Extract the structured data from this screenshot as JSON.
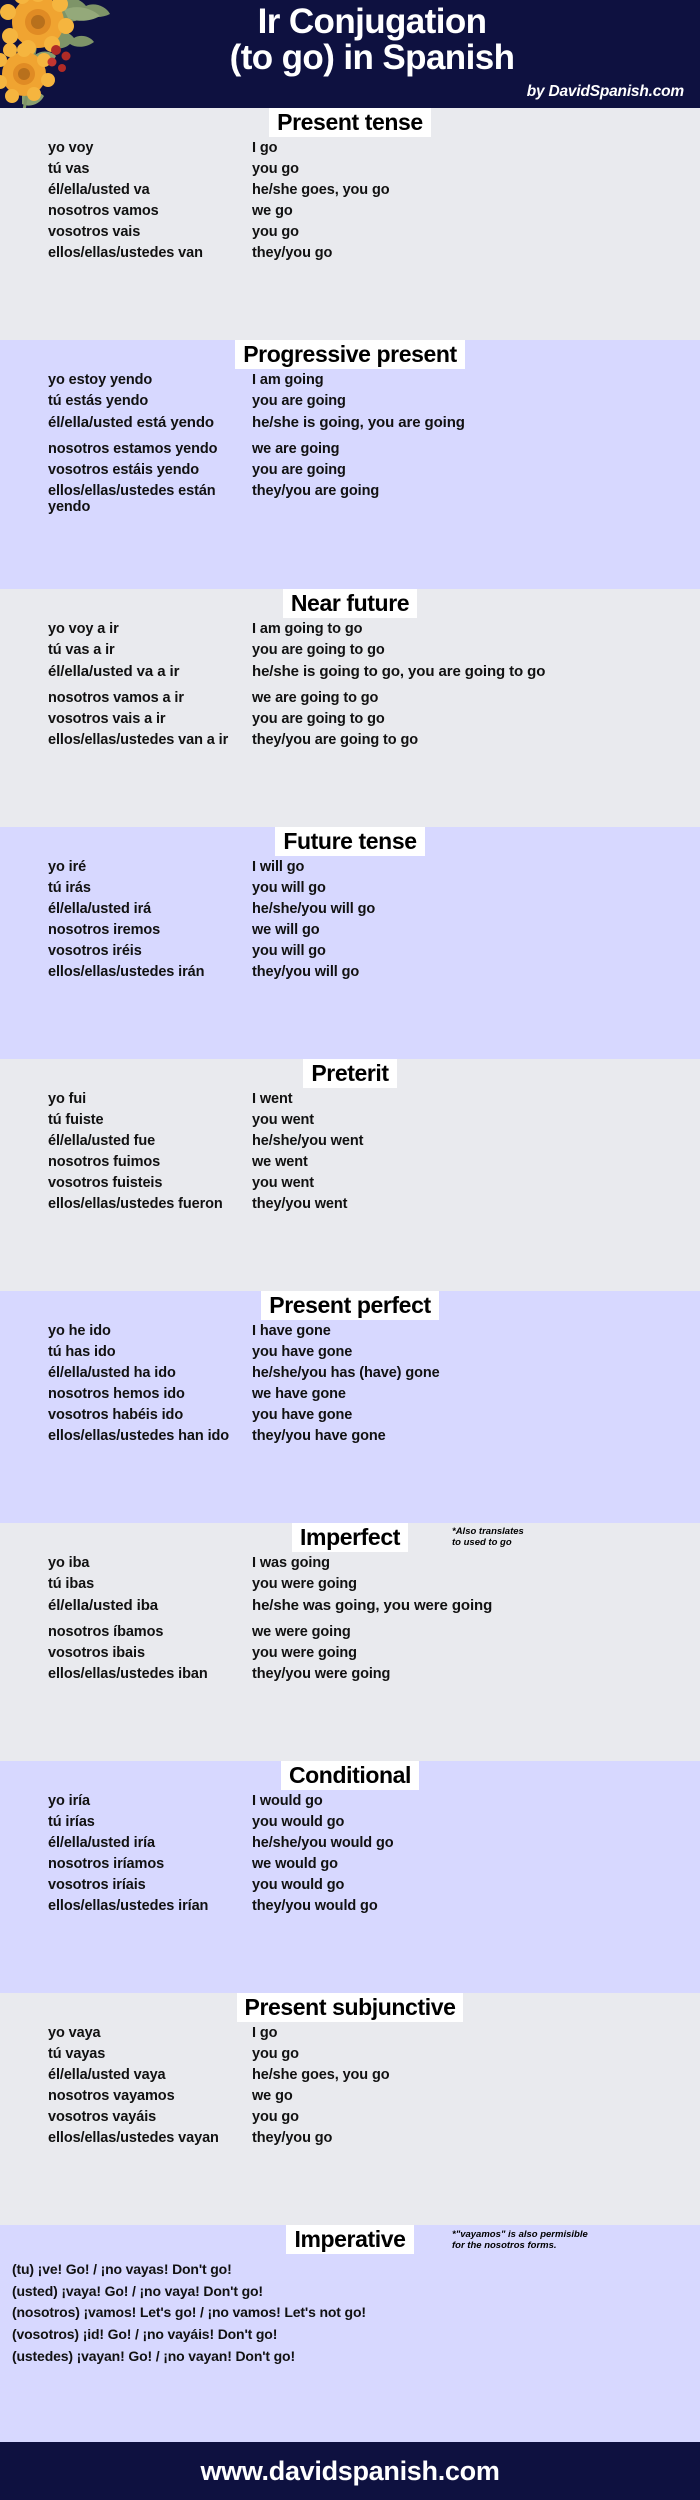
{
  "header": {
    "title_line1": "Ir Conjugation",
    "title_line2": "(to go) in Spanish",
    "byline": "by DavidSpanish.com",
    "background_color": "#0e1140",
    "floral_icon": "floral-decoration"
  },
  "theme": {
    "plain_background": "#e9eaee",
    "alt_background": "#d7d8ff",
    "title_chip_background": "#ffffff",
    "text_color": "#111111"
  },
  "sections": [
    {
      "title": "Present tense",
      "shade": "plain",
      "note": "",
      "rows": [
        {
          "es": "yo voy",
          "en": "I go",
          "en_small": false
        },
        {
          "es": "tú vas",
          "en": "you go",
          "en_small": false
        },
        {
          "es": "él/ella/usted va",
          "en": "he/she goes, you go",
          "en_small": false
        },
        {
          "es": "nosotros vamos",
          "en": "we go",
          "en_small": false
        },
        {
          "es": "vosotros vais",
          "en": "you go",
          "en_small": false
        },
        {
          "es": "ellos/ellas/ustedes van",
          "en": "they/you go",
          "en_small": false
        }
      ]
    },
    {
      "title": "Progressive present",
      "shade": "alt",
      "note": "",
      "rows": [
        {
          "es": "yo estoy yendo",
          "en": "I am going",
          "en_small": false
        },
        {
          "es": "tú estás yendo",
          "en": "you are going",
          "en_small": false
        },
        {
          "es": "él/ella/usted está yendo",
          "en": "he/she is going, you are going",
          "en_small": true
        },
        {
          "es": "nosotros estamos yendo",
          "en": "we are going",
          "en_small": false
        },
        {
          "es": "vosotros estáis yendo",
          "en": "you are going",
          "en_small": false
        },
        {
          "es": "ellos/ellas/ustedes están yendo",
          "en": "they/you are going",
          "en_small": false
        }
      ]
    },
    {
      "title": "Near future",
      "shade": "plain",
      "note": "",
      "rows": [
        {
          "es": "yo voy a ir",
          "en": "I am going to go",
          "en_small": false
        },
        {
          "es": "tú vas a ir",
          "en": "you are going to go",
          "en_small": false
        },
        {
          "es": "él/ella/usted va a ir",
          "en": "he/she is going to go, you are going to go",
          "en_small": true
        },
        {
          "es": "nosotros vamos a ir",
          "en": "we are going to go",
          "en_small": false
        },
        {
          "es": "vosotros vais a ir",
          "en": "you are going to go",
          "en_small": false
        },
        {
          "es": "ellos/ellas/ustedes van a ir",
          "en": "they/you are going to go",
          "en_small": false
        }
      ]
    },
    {
      "title": "Future tense",
      "shade": "alt",
      "note": "",
      "rows": [
        {
          "es": "yo iré",
          "en": "I will go",
          "en_small": false
        },
        {
          "es": "tú irás",
          "en": "you will go",
          "en_small": false
        },
        {
          "es": "él/ella/usted irá",
          "en": "he/she/you will go",
          "en_small": false
        },
        {
          "es": "nosotros iremos",
          "en": "we will go",
          "en_small": false
        },
        {
          "es": "vosotros iréis",
          "en": "you will go",
          "en_small": false
        },
        {
          "es": "ellos/ellas/ustedes irán",
          "en": "they/you will go",
          "en_small": false
        }
      ]
    },
    {
      "title": "Preterit",
      "shade": "plain",
      "note": "",
      "rows": [
        {
          "es": "yo fui",
          "en": "I went",
          "en_small": false
        },
        {
          "es": "tú fuiste",
          "en": "you went",
          "en_small": false
        },
        {
          "es": "él/ella/usted fue",
          "en": "he/she/you went",
          "en_small": false
        },
        {
          "es": "nosotros fuimos",
          "en": "we went",
          "en_small": false
        },
        {
          "es": "vosotros fuisteis",
          "en": "you went",
          "en_small": false
        },
        {
          "es": "ellos/ellas/ustedes fueron",
          "en": "they/you went",
          "en_small": false
        }
      ]
    },
    {
      "title": "Present perfect",
      "shade": "alt",
      "note": "",
      "rows": [
        {
          "es": "yo he ido",
          "en": "I have gone",
          "en_small": false
        },
        {
          "es": "tú has ido",
          "en": "you have gone",
          "en_small": false
        },
        {
          "es": "él/ella/usted ha ido",
          "en": "he/she/you has (have) gone",
          "en_small": false
        },
        {
          "es": "nosotros hemos ido",
          "en": "we have gone",
          "en_small": false
        },
        {
          "es": "vosotros habéis ido",
          "en": "you have gone",
          "en_small": false
        },
        {
          "es": "ellos/ellas/ustedes han ido",
          "en": "they/you have gone",
          "en_small": false
        }
      ]
    },
    {
      "title": "Imperfect",
      "shade": "plain",
      "note": "*Also translates\nto used to go",
      "rows": [
        {
          "es": "yo iba",
          "en": "I was going",
          "en_small": false
        },
        {
          "es": "tú ibas",
          "en": "you were going",
          "en_small": false
        },
        {
          "es": "él/ella/usted iba",
          "en": "he/she was going, you were going",
          "en_small": true
        },
        {
          "es": "nosotros íbamos",
          "en": "we were going",
          "en_small": false
        },
        {
          "es": "vosotros ibais",
          "en": "you were going",
          "en_small": false
        },
        {
          "es": "ellos/ellas/ustedes iban",
          "en": "they/you were going",
          "en_small": false
        }
      ]
    },
    {
      "title": "Conditional",
      "shade": "alt",
      "note": "",
      "rows": [
        {
          "es": "yo iría",
          "en": "I would go",
          "en_small": false
        },
        {
          "es": "tú irías",
          "en": "you would go",
          "en_small": false
        },
        {
          "es": "él/ella/usted iría",
          "en": "he/she/you would go",
          "en_small": false
        },
        {
          "es": "nosotros iríamos",
          "en": "we would go",
          "en_small": false
        },
        {
          "es": "vosotros iríais",
          "en": "you would go",
          "en_small": false
        },
        {
          "es": "ellos/ellas/ustedes irían",
          "en": "they/you would go",
          "en_small": false
        }
      ]
    },
    {
      "title": "Present subjunctive",
      "shade": "plain",
      "note": "",
      "rows": [
        {
          "es": "yo vaya",
          "en": "I go",
          "en_small": false
        },
        {
          "es": "tú vayas",
          "en": "you go",
          "en_small": false
        },
        {
          "es": "él/ella/usted vaya",
          "en": "he/she goes, you go",
          "en_small": false
        },
        {
          "es": "nosotros vayamos",
          "en": "we go",
          "en_small": false
        },
        {
          "es": "vosotros vayáis",
          "en": "you go",
          "en_small": false
        },
        {
          "es": "ellos/ellas/ustedes vayan",
          "en": "they/you go",
          "en_small": false
        }
      ]
    }
  ],
  "imperative": {
    "title": "Imperative",
    "shade": "alt",
    "note": "*\"vayamos\" is also permisible\nfor the nosotros forms.",
    "items": [
      "(tu) ¡ve! Go! / ¡no vayas! Don't go!",
      "(usted) ¡vaya! Go! / ¡no vaya! Don't go!",
      "(nosotros)  ¡vamos! Let's go! / ¡no vamos! Let's not go!",
      "(vosotros) ¡id! Go! / ¡no vayáis! Don't go!",
      "(ustedes) ¡vayan! Go! / ¡no vayan! Don't go!"
    ]
  },
  "footer": {
    "url": "www.davidspanish.com",
    "background_color": "#0e1140"
  }
}
